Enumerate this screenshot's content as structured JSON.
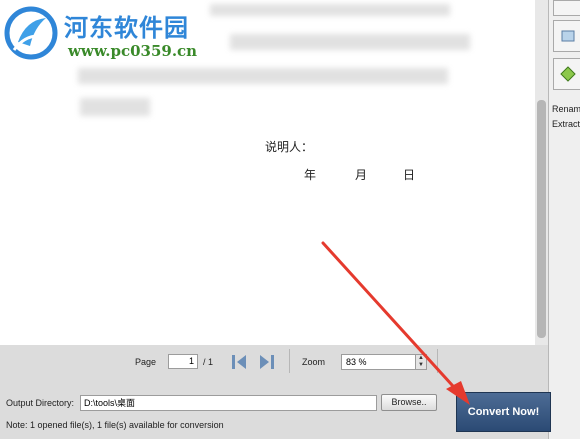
{
  "watermark": {
    "title": "河东软件园",
    "url": "www.pc0359.cn"
  },
  "document": {
    "signer_label": "说明人：",
    "date_year": "年",
    "date_month": "月",
    "date_day": "日"
  },
  "right_panel": {
    "rename_label": "Renam",
    "extract_label": "Extract"
  },
  "page_nav": {
    "page_label": "Page",
    "page_value": "1",
    "page_total": "/ 1",
    "zoom_label": "Zoom",
    "zoom_value": "83 %"
  },
  "output": {
    "label": "Output Directory:",
    "value": "D:\\tools\\桌面",
    "browse_label": "Browse..",
    "status": "Note: 1 opened file(s), 1 file(s) available for conversion"
  },
  "convert_button": {
    "label": "Convert Now!"
  },
  "colors": {
    "arrow": "#e53a2e",
    "convert_bg": "#3a5a84",
    "nav_icon": "#6c8fb8",
    "watermark_blue": "#2f86d8",
    "watermark_green": "#3a8a2a"
  },
  "icons": [
    "watermark-logo-icon",
    "first-page-icon",
    "last-page-icon",
    "zoom-spin-icon",
    "panel-icon"
  ]
}
